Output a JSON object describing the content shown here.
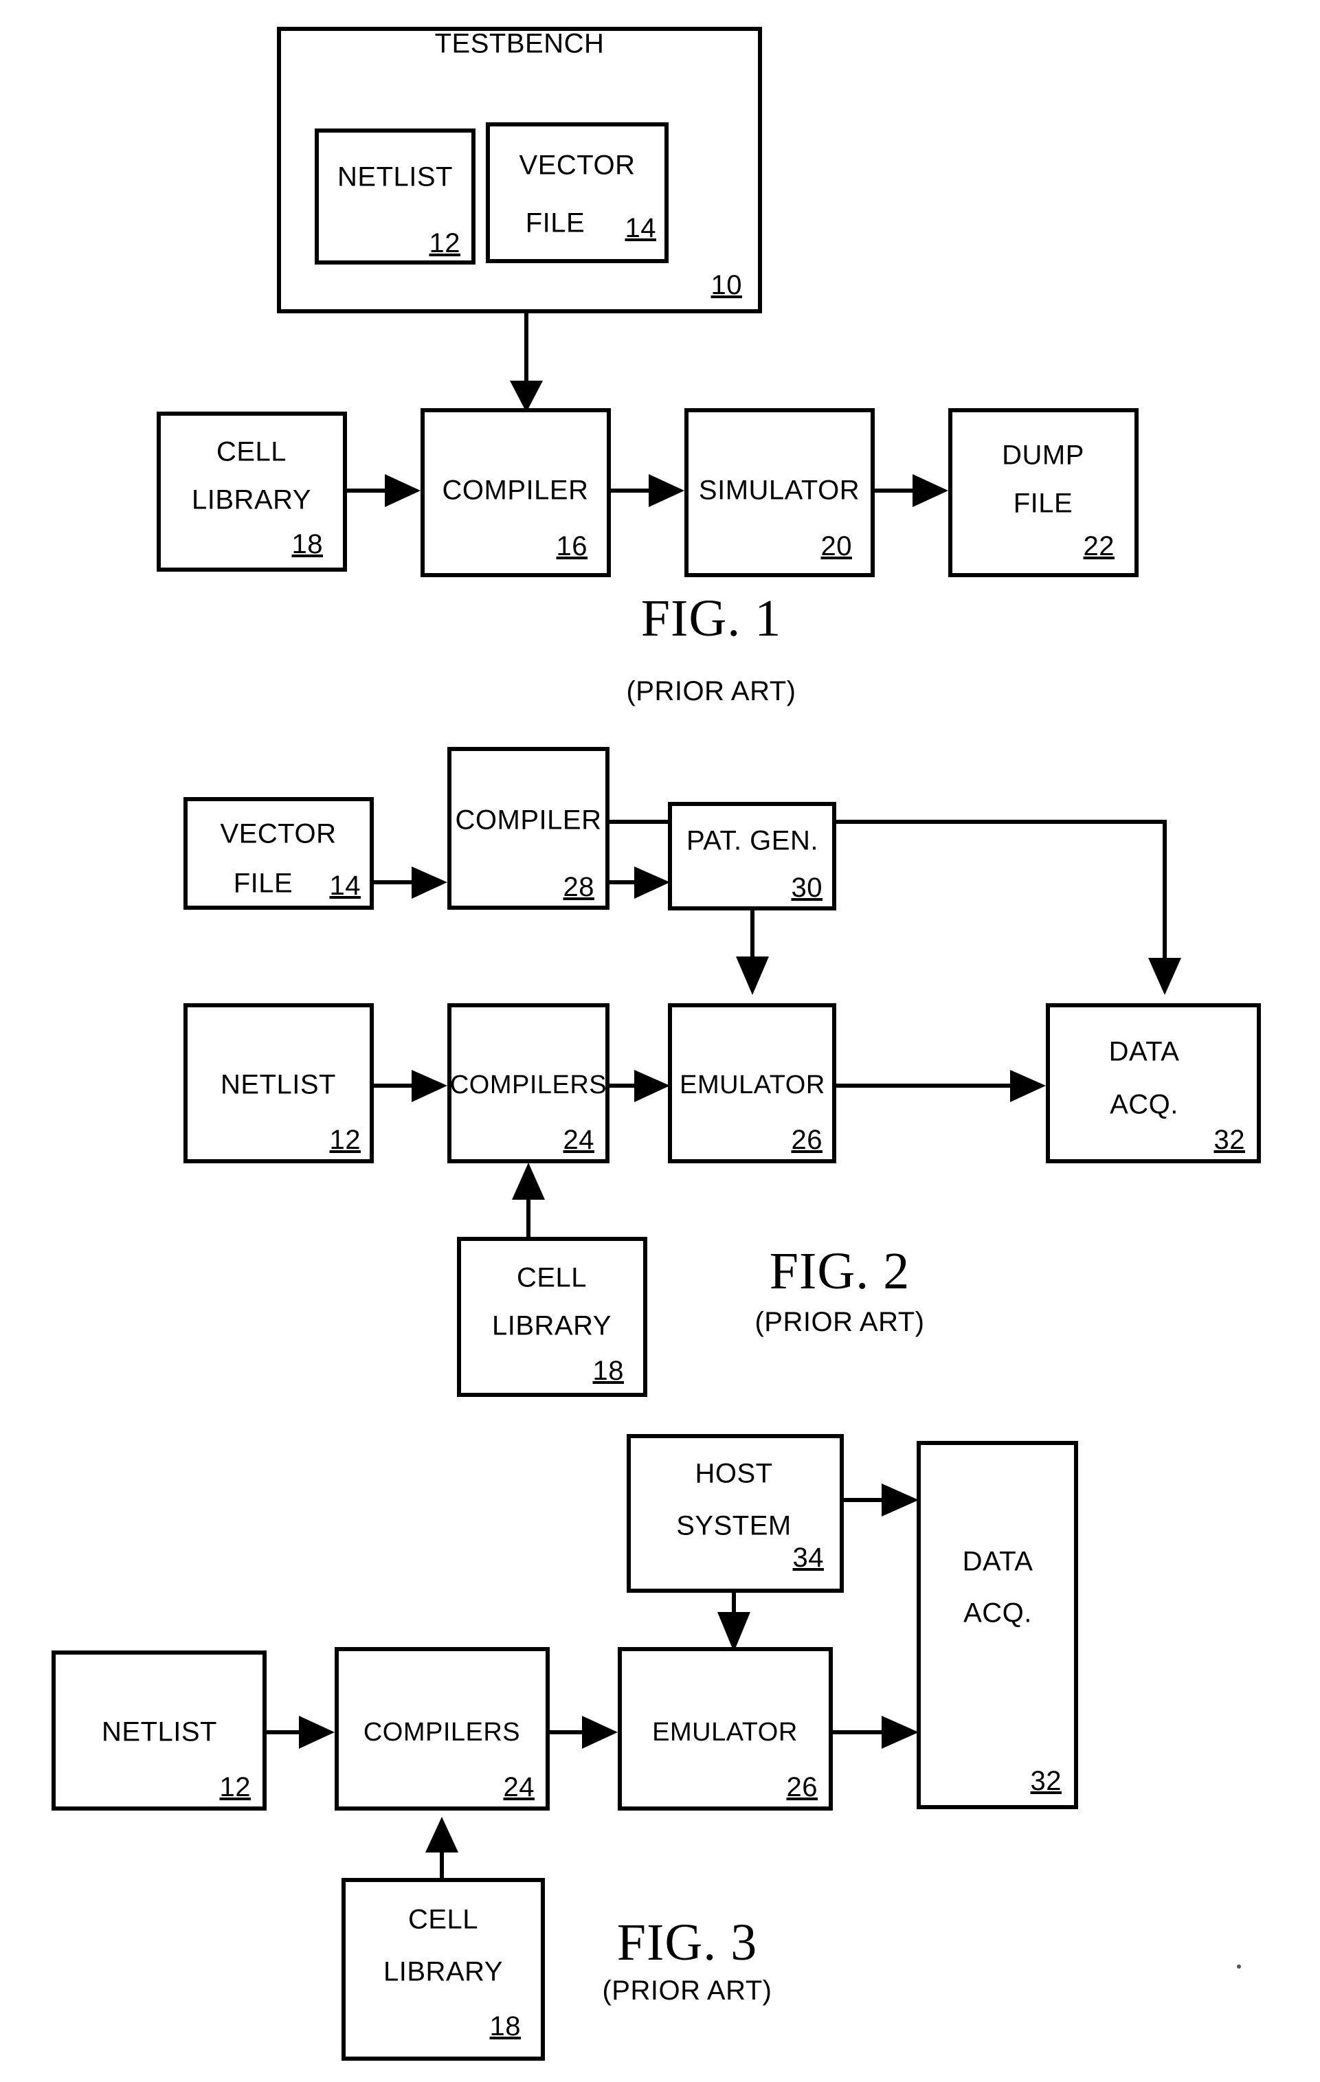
{
  "document": {
    "type": "patent-drawing-sheet",
    "figure_count": 3
  },
  "figures": [
    {
      "id": "fig1",
      "caption": "FIG. 1",
      "subcaption": "(PRIOR ART)",
      "blocks": [
        {
          "key": "testbench",
          "label": "TESTBENCH",
          "ref": "10"
        },
        {
          "key": "netlist",
          "label": "NETLIST",
          "ref": "12"
        },
        {
          "key": "vector_file_l1",
          "label": "VECTOR",
          "label2": "FILE",
          "ref": "14"
        },
        {
          "key": "cell_library",
          "label": "CELL",
          "label2": "LIBRARY",
          "ref": "18"
        },
        {
          "key": "compiler",
          "label": "COMPILER",
          "ref": "16"
        },
        {
          "key": "simulator",
          "label": "SIMULATOR",
          "ref": "20"
        },
        {
          "key": "dump_file",
          "label": "DUMP",
          "label2": "FILE",
          "ref": "22"
        }
      ]
    },
    {
      "id": "fig2",
      "caption": "FIG. 2",
      "subcaption": "(PRIOR ART)",
      "blocks": [
        {
          "key": "vector_file",
          "label": "VECTOR",
          "label2": "FILE",
          "ref": "14"
        },
        {
          "key": "compiler",
          "label": "COMPILER",
          "ref": "28"
        },
        {
          "key": "pat_gen",
          "label": "PAT. GEN.",
          "ref": "30"
        },
        {
          "key": "netlist",
          "label": "NETLIST",
          "ref": "12"
        },
        {
          "key": "compilers",
          "label": "COMPILERS",
          "ref": "24"
        },
        {
          "key": "emulator",
          "label": "EMULATOR",
          "ref": "26"
        },
        {
          "key": "data_acq",
          "label": "DATA",
          "label2": "ACQ.",
          "ref": "32"
        },
        {
          "key": "cell_library",
          "label": "CELL",
          "label2": "LIBRARY",
          "ref": "18"
        }
      ]
    },
    {
      "id": "fig3",
      "caption": "FIG. 3",
      "subcaption": "(PRIOR ART)",
      "blocks": [
        {
          "key": "host_system",
          "label": "HOST",
          "label2": "SYSTEM",
          "ref": "34"
        },
        {
          "key": "data_acq",
          "label": "DATA",
          "label2": "ACQ.",
          "ref": "32"
        },
        {
          "key": "netlist",
          "label": "NETLIST",
          "ref": "12"
        },
        {
          "key": "compilers",
          "label": "COMPILERS",
          "ref": "24"
        },
        {
          "key": "emulator",
          "label": "EMULATOR",
          "ref": "26"
        },
        {
          "key": "cell_library",
          "label": "CELL",
          "label2": "LIBRARY",
          "ref": "18"
        }
      ]
    }
  ],
  "colors": {
    "ink": "#000000",
    "paper": "#ffffff"
  }
}
